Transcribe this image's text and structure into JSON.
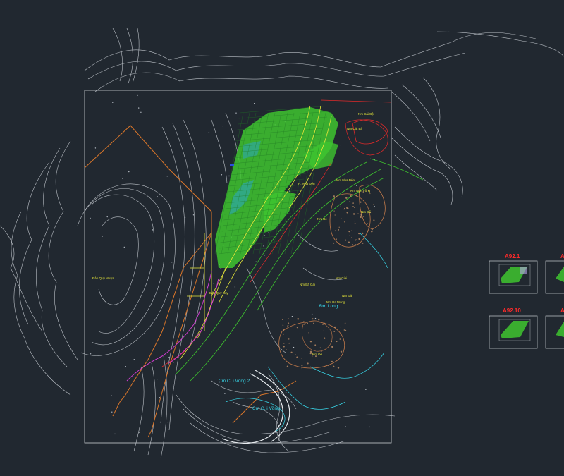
{
  "drawing": {
    "colors": {
      "background": "#212830",
      "contour": "#d8dde3",
      "boundary": "#c8cdd2",
      "orange": "#d9762a",
      "green": "#3ec42f",
      "yellow": "#e6e63a",
      "magenta": "#d23cd2",
      "cyan": "#38d6e8",
      "red": "#e02a2a",
      "brown": "#c27a4a",
      "sheet_title": "#ff2a2a"
    },
    "labels": [
      {
        "text": "Nm Cái Bộ",
        "color": "yellow"
      },
      {
        "text": "Nm Cát Bà",
        "color": "yellow"
      },
      {
        "text": "H. Nha Đến",
        "color": "yellow"
      },
      {
        "text": "Nm Nha Đến",
        "color": "yellow"
      },
      {
        "text": "Nm Ngh Vồng",
        "color": "yellow"
      },
      {
        "text": "Nm Bổ",
        "color": "yellow"
      },
      {
        "text": "Nm Bé",
        "color": "yellow"
      },
      {
        "text": "Đảo Quỳ Mượn",
        "color": "yellow"
      },
      {
        "text": "Đảo Quỳ Xuy",
        "color": "yellow"
      },
      {
        "text": "Nm Bã Gai",
        "color": "yellow"
      },
      {
        "text": "Nm Giai",
        "color": "yellow"
      },
      {
        "text": "Nm Đá",
        "color": "yellow"
      },
      {
        "text": "Nm Ba Mong",
        "color": "yellow"
      },
      {
        "text": "Đm Long",
        "color": "cyan"
      },
      {
        "text": "Nm Đề",
        "color": "yellow"
      },
      {
        "text": "Cm C. i Vồng 2",
        "color": "cyan"
      },
      {
        "text": "Cm C. i Vồng",
        "color": "cyan"
      }
    ],
    "sheets": [
      {
        "title": "A92.1"
      },
      {
        "title": "A"
      },
      {
        "title": "A92.10"
      },
      {
        "title": "A"
      }
    ]
  }
}
